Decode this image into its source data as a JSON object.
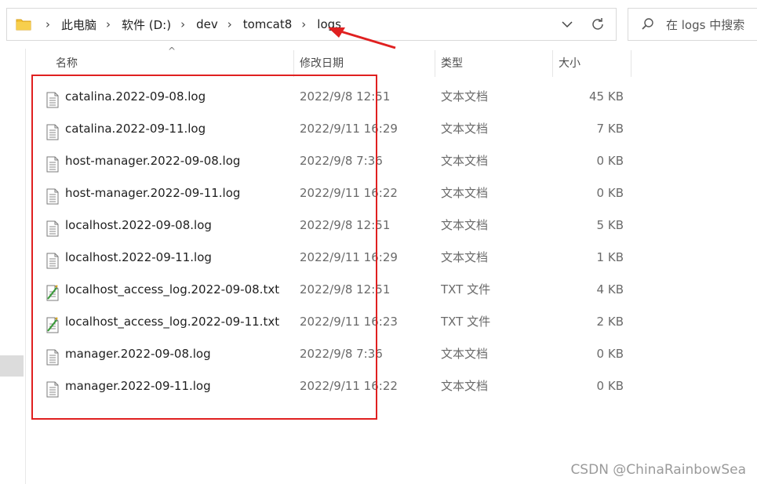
{
  "breadcrumb": [
    "此电脑",
    "软件 (D:)",
    "dev",
    "tomcat8",
    "logs"
  ],
  "search": {
    "placeholder": "在 logs 中搜索"
  },
  "columns": {
    "name": "名称",
    "date": "修改日期",
    "type": "类型",
    "size": "大小"
  },
  "files": [
    {
      "name": "catalina.2022-09-08.log",
      "date": "2022/9/8 12:51",
      "type": "文本文档",
      "size": "45 KB",
      "icon": "text-file-icon"
    },
    {
      "name": "catalina.2022-09-11.log",
      "date": "2022/9/11 16:29",
      "type": "文本文档",
      "size": "7 KB",
      "icon": "text-file-icon"
    },
    {
      "name": "host-manager.2022-09-08.log",
      "date": "2022/9/8 7:36",
      "type": "文本文档",
      "size": "0 KB",
      "icon": "text-file-icon"
    },
    {
      "name": "host-manager.2022-09-11.log",
      "date": "2022/9/11 16:22",
      "type": "文本文档",
      "size": "0 KB",
      "icon": "text-file-icon"
    },
    {
      "name": "localhost.2022-09-08.log",
      "date": "2022/9/8 12:51",
      "type": "文本文档",
      "size": "5 KB",
      "icon": "text-file-icon"
    },
    {
      "name": "localhost.2022-09-11.log",
      "date": "2022/9/11 16:29",
      "type": "文本文档",
      "size": "1 KB",
      "icon": "text-file-icon"
    },
    {
      "name": "localhost_access_log.2022-09-08.txt",
      "date": "2022/9/8 12:51",
      "type": "TXT 文件",
      "size": "4 KB",
      "icon": "txt-file-icon"
    },
    {
      "name": "localhost_access_log.2022-09-11.txt",
      "date": "2022/9/11 16:23",
      "type": "TXT 文件",
      "size": "2 KB",
      "icon": "txt-file-icon"
    },
    {
      "name": "manager.2022-09-08.log",
      "date": "2022/9/8 7:36",
      "type": "文本文档",
      "size": "0 KB",
      "icon": "text-file-icon"
    },
    {
      "name": "manager.2022-09-11.log",
      "date": "2022/9/11 16:22",
      "type": "文本文档",
      "size": "0 KB",
      "icon": "text-file-icon"
    }
  ],
  "watermark": "CSDN @ChinaRainbowSea",
  "colors": {
    "annotation": "#e02020",
    "folder": "#f3c133"
  }
}
